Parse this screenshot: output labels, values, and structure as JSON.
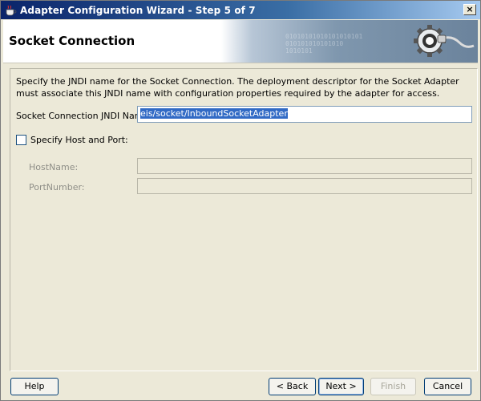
{
  "window": {
    "title": "Adapter Configuration Wizard - Step 5 of 7",
    "close_label": "×"
  },
  "header": {
    "page_title": "Socket Connection",
    "banner_binary": "01010101010101010101\n010101010101010\n1010101"
  },
  "content": {
    "description": "Specify the JNDI name for the Socket Connection.  The deployment descriptor for the Socket Adapter must associate this JNDI name with configuration properties required by the adapter for access.",
    "jndi": {
      "label": "Socket Connection JNDI Name",
      "value": "eis/socket/InboundSocketAdapter"
    },
    "specify_host_port": {
      "label": "Specify Host and Port:",
      "checked": false
    },
    "hostname": {
      "label": "HostName:",
      "value": ""
    },
    "portnumber": {
      "label": "PortNumber:",
      "value": ""
    }
  },
  "buttons": {
    "help": "Help",
    "back": "< Back",
    "next": "Next >",
    "finish": "Finish",
    "cancel": "Cancel"
  },
  "colors": {
    "titlebar_start": "#0a246a",
    "titlebar_end": "#a6caf0",
    "dialog_bg": "#ece9d8",
    "selection": "#316ac5"
  }
}
